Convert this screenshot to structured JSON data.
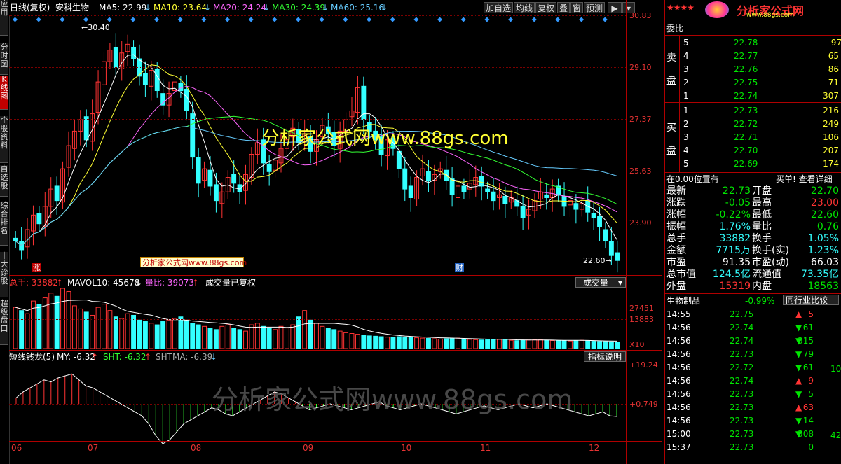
{
  "left_tabs": [
    "应用",
    "分时图",
    "K线图",
    "个股资料",
    "自选股",
    "综合排名",
    "十大诊股",
    "超级盘口"
  ],
  "header": {
    "period": "日线(复权)",
    "stock_name": "安科生物",
    "ma": [
      {
        "label": "MA5: 22.99",
        "color": "#ffffff"
      },
      {
        "label": "MA10: 23.64",
        "color": "#ffff33"
      },
      {
        "label": "MA20: 24.24",
        "color": "#ff66ff"
      },
      {
        "label": "MA30: 24.39",
        "color": "#33ff33"
      },
      {
        "label": "MA60: 25.16",
        "color": "#66ccff"
      }
    ],
    "arrow_down": "↓",
    "buttons": [
      "加自选",
      "均线",
      "复权",
      "叠",
      "窗",
      "预测"
    ],
    "nav": "▶",
    "nav2": "▾"
  },
  "price_axis": [
    "30.83",
    "29.10",
    "27.37",
    "25.63",
    "23.90"
  ],
  "volume_axis": [
    "27451",
    "13883",
    "X10"
  ],
  "indicator_axis": [
    "+19.24",
    "+0.749"
  ],
  "month_labels": [
    "06",
    "07",
    "08",
    "09",
    "10",
    "11",
    "12"
  ],
  "annotations": {
    "high": "←30.40",
    "low": "22.60→",
    "zhang": "涨",
    "cai": "财",
    "promo_box": "分析家公式网www.88gs.com",
    "watermark_mid": "分析家公式网www.88gs.com",
    "watermark_big": "分析家公式网www.88gs.com"
  },
  "volume_header": {
    "total": "总手: 33882",
    "mavol": "MAVOL10: 45678",
    "ratio": "量比: 39073",
    "note": "成交量已复权",
    "select": "成交量",
    "up": "↑",
    "down": "↓"
  },
  "indicator_header": {
    "name": "短线钱龙(5)",
    "my": "MY: -6.32",
    "sht": "SHT: -6.32",
    "shtma": "SHTMA: -6.39",
    "button": "指标说明",
    "up": "↑",
    "down": "↓"
  },
  "logo": {
    "stars": "★★★★",
    "text": "分析家公式网",
    "url": "www.88gs.com"
  },
  "orderbook": {
    "title": "委比",
    "sell_label": [
      "卖",
      "盘"
    ],
    "buy_label": [
      "买",
      "盘"
    ],
    "sell": [
      {
        "lvl": "5",
        "price": "22.78",
        "vol": "97"
      },
      {
        "lvl": "4",
        "price": "22.77",
        "vol": "65"
      },
      {
        "lvl": "3",
        "price": "22.76",
        "vol": "86"
      },
      {
        "lvl": "2",
        "price": "22.75",
        "vol": "71"
      },
      {
        "lvl": "1",
        "price": "22.74",
        "vol": "307"
      }
    ],
    "buy": [
      {
        "lvl": "1",
        "price": "22.73",
        "vol": "216"
      },
      {
        "lvl": "2",
        "price": "22.72",
        "vol": "249"
      },
      {
        "lvl": "3",
        "price": "22.71",
        "vol": "106"
      },
      {
        "lvl": "4",
        "price": "22.70",
        "vol": "207"
      },
      {
        "lvl": "5",
        "price": "22.69",
        "vol": "174"
      }
    ]
  },
  "position_bar": {
    "left": "在0.00位置有",
    "right": "买单! 查看详细"
  },
  "stats": [
    {
      "l1": "最新",
      "v1": "22.73",
      "c1": "green",
      "l2": "开盘",
      "v2": "22.70",
      "c2": "green"
    },
    {
      "l1": "涨跌",
      "v1": "-0.05",
      "c1": "green",
      "l2": "最高",
      "v2": "23.00",
      "c2": "red"
    },
    {
      "l1": "涨幅",
      "v1": "-0.22%",
      "c1": "green",
      "l2": "最低",
      "v2": "22.60",
      "c2": "green"
    },
    {
      "l1": "振幅",
      "v1": "1.76%",
      "c1": "cyan",
      "l2": "量比",
      "v2": "0.76",
      "c2": "green"
    },
    {
      "l1": "总手",
      "v1": "33882",
      "c1": "cyan",
      "l2": "换手",
      "v2": "1.05%",
      "c2": "cyan"
    },
    {
      "l1": "金额",
      "v1": "7715万",
      "c1": "cyan",
      "l2": "换手(实)",
      "v2": "1.23%",
      "c2": "cyan"
    },
    {
      "l1": "市盈",
      "v1": "91.35",
      "c1": "white",
      "l2": "市盈(动)",
      "v2": "66.03",
      "c2": "white"
    },
    {
      "l1": "总市值",
      "v1": "124.5亿",
      "c1": "cyan",
      "l2": "流通值",
      "v2": "73.35亿",
      "c2": "cyan"
    },
    {
      "l1": "外盘",
      "v1": "15319",
      "c1": "red",
      "l2": "内盘",
      "v2": "18563",
      "c2": "green"
    }
  ],
  "sector": {
    "name": "生物制品",
    "change": "-0.99%",
    "button": "同行业比较"
  },
  "ticks": [
    {
      "time": "14:55",
      "price": "22.75",
      "vol": "5",
      "dir": "up"
    },
    {
      "time": "14:56",
      "price": "22.74",
      "vol": "61",
      "dir": "down"
    },
    {
      "time": "14:56",
      "price": "22.74",
      "vol": "315",
      "dir": "down"
    },
    {
      "time": "14:56",
      "price": "22.73",
      "vol": "79",
      "dir": "down"
    },
    {
      "time": "14:56",
      "price": "22.72",
      "vol": "61",
      "dir": "down"
    },
    {
      "time": "14:56",
      "price": "22.74",
      "vol": "9",
      "dir": "up"
    },
    {
      "time": "14:56",
      "price": "22.73",
      "vol": "5",
      "dir": "down"
    },
    {
      "time": "14:56",
      "price": "22.73",
      "vol": "63",
      "dir": "up"
    },
    {
      "time": "14:56",
      "price": "22.73",
      "vol": "14",
      "dir": "down"
    },
    {
      "time": "15:00",
      "price": "22.73",
      "vol": "308",
      "dir": "down"
    },
    {
      "time": "15:37",
      "price": "22.73",
      "vol": "0",
      "dir": "none"
    }
  ],
  "tick_extra": [
    "10",
    "42"
  ],
  "colors": {
    "up": "#ff3333",
    "down": "#33ffff",
    "grid": "#7a0000",
    "border": "#b00000"
  },
  "chart_data": {
    "type": "candlestick",
    "x_axis": [
      "06",
      "07",
      "08",
      "09",
      "10",
      "11",
      "12"
    ],
    "ylim": [
      22.3,
      31.2
    ],
    "price_high_label": 30.4,
    "price_low_label": 22.6,
    "closes": [
      23.4,
      23.1,
      23.8,
      24.3,
      24.0,
      24.6,
      25.2,
      24.8,
      25.9,
      26.7,
      27.2,
      27.6,
      26.9,
      27.8,
      28.9,
      29.6,
      30.0,
      29.4,
      29.9,
      30.2,
      29.7,
      29.1,
      28.8,
      29.3,
      28.6,
      28.1,
      28.5,
      28.9,
      28.6,
      27.9,
      26.3,
      25.4,
      25.9,
      25.3,
      24.8,
      25.1,
      25.6,
      25.4,
      25.1,
      25.7,
      26.4,
      26.8,
      26.1,
      25.8,
      26.2,
      26.6,
      26.9,
      27.3,
      26.8,
      27.1,
      26.5,
      26.9,
      27.4,
      27.1,
      26.7,
      27.2,
      27.6,
      27.9,
      28.7,
      27.6,
      27.2,
      26.9,
      26.4,
      26.9,
      26.6,
      25.9,
      25.2,
      24.9,
      25.6,
      25.9,
      25.5,
      25.7,
      25.9,
      25.5,
      25.0,
      25.3,
      25.1,
      25.4,
      25.6,
      25.3,
      25.1,
      24.8,
      25.0,
      24.7,
      24.9,
      24.6,
      24.2,
      24.5,
      24.8,
      25.1,
      24.9,
      25.2,
      25.0,
      24.6,
      24.8,
      24.5,
      24.7,
      24.4,
      24.2,
      23.9,
      23.4,
      22.9,
      22.73
    ],
    "volumes": [
      260,
      240,
      220,
      300,
      280,
      320,
      350,
      330,
      380,
      360,
      270,
      250,
      230,
      210,
      260,
      280,
      240,
      200,
      190,
      220,
      210,
      180,
      170,
      160,
      150,
      170,
      180,
      190,
      200,
      180,
      160,
      150,
      140,
      130,
      120,
      140,
      150,
      130,
      120,
      110,
      150,
      160,
      140,
      130,
      120,
      140,
      130,
      150,
      200,
      240,
      180,
      160,
      140,
      130,
      120,
      110,
      100,
      95,
      90,
      85,
      80,
      78,
      75,
      72,
      70,
      75,
      73,
      70,
      68,
      66,
      64,
      62,
      60,
      62,
      64,
      66,
      60,
      58,
      56,
      54,
      55,
      56,
      58,
      55,
      52,
      50,
      52,
      54,
      56,
      55,
      53,
      51,
      50,
      49,
      48,
      50,
      52,
      48,
      46,
      45,
      44,
      43,
      42
    ],
    "my": [
      3,
      6,
      8,
      10,
      12,
      11,
      13,
      14,
      15,
      12,
      9,
      8,
      6,
      4,
      2,
      0,
      -2,
      -4,
      -6,
      -10,
      -16,
      -20,
      -18,
      -14,
      -10,
      -8,
      -6,
      -4,
      -2,
      -3,
      -5,
      -6,
      -4,
      -2,
      0,
      2,
      4,
      6,
      5,
      3,
      1,
      -1,
      -3,
      -2,
      -1,
      0,
      -1,
      -2,
      -3,
      -2,
      -1,
      0,
      1,
      -1,
      -2,
      -3,
      -2,
      -1,
      0,
      -1,
      -2,
      -3,
      -4,
      -5,
      -4,
      -3,
      -2,
      -1,
      -2,
      -3,
      -2,
      -1,
      0,
      -1,
      -2,
      -1,
      0,
      -1,
      -2,
      -3,
      -4,
      -5,
      -6,
      -5,
      -4,
      -6,
      -6.32
    ]
  }
}
